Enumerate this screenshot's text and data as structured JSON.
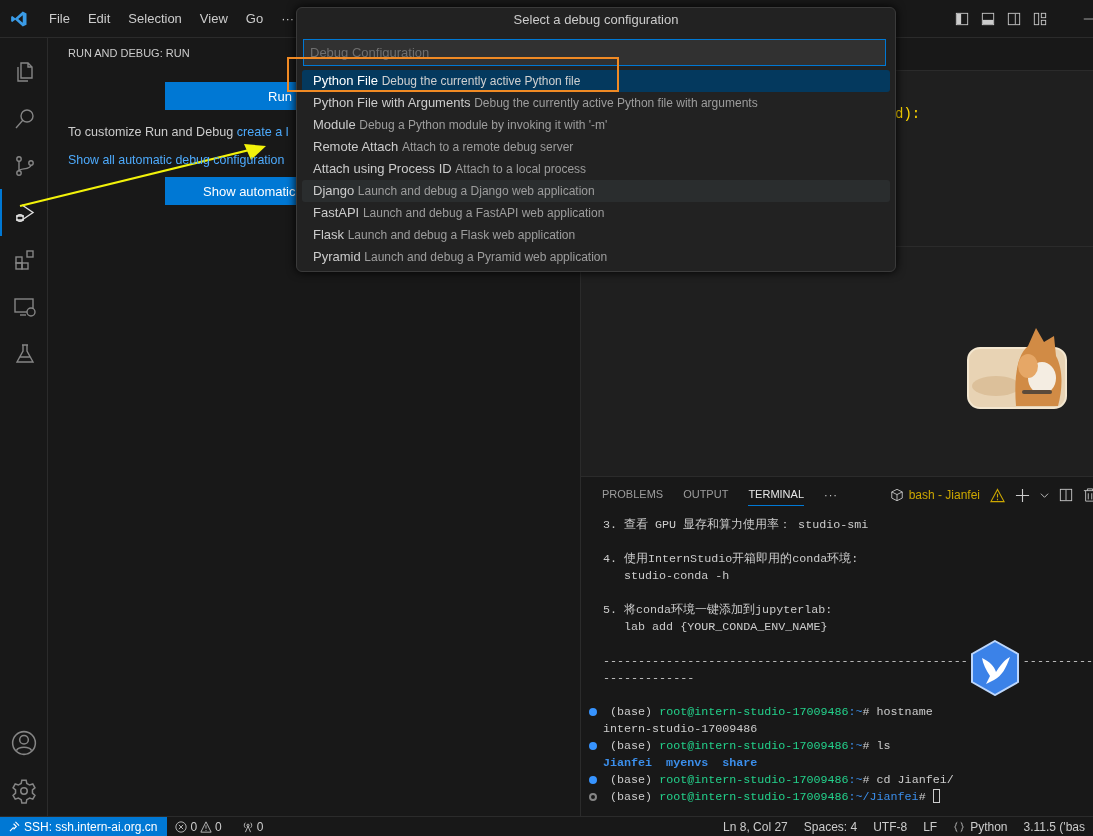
{
  "title_bar": {
    "menu": [
      "File",
      "Edit",
      "Selection",
      "View",
      "Go",
      "···"
    ],
    "layout_buttons": [
      {
        "kind": "sidebar-left"
      },
      {
        "kind": "panel"
      },
      {
        "kind": "sidebar-right"
      },
      {
        "kind": "customize"
      },
      {
        "kind": "minimize"
      }
    ]
  },
  "activity_bar": {
    "items": [
      {
        "kind": "explorer",
        "selected": false
      },
      {
        "kind": "search",
        "selected": false
      },
      {
        "kind": "source-control",
        "selected": false
      },
      {
        "kind": "run-debug",
        "selected": true
      },
      {
        "kind": "extensions",
        "selected": false
      },
      {
        "kind": "remote",
        "selected": false
      },
      {
        "kind": "testing",
        "selected": false
      }
    ],
    "bottom": [
      {
        "kind": "account"
      },
      {
        "kind": "settings"
      }
    ]
  },
  "sidebar": {
    "title": "RUN AND DEBUG: RUN",
    "run_button": "Run",
    "customize_text": "To customize Run and Debug",
    "create_link": "create a l",
    "show_all_link": "Show all automatic debug configuration",
    "show_button": "Show automatic"
  },
  "editor": {
    "code_fragment": "d):"
  },
  "palette": {
    "title": "Select a debug configuration",
    "placeholder": "Debug Configuration",
    "items": [
      {
        "label": "Python File",
        "description": "Debug the currently active Python file",
        "selected": true,
        "hovered": false
      },
      {
        "label": "Python File with Arguments",
        "description": "Debug the currently active Python file with arguments",
        "selected": false,
        "hovered": false
      },
      {
        "label": "Module",
        "description": "Debug a Python module by invoking it with '-m'",
        "selected": false,
        "hovered": false
      },
      {
        "label": "Remote Attach",
        "description": "Attach to a remote debug server",
        "selected": false,
        "hovered": false
      },
      {
        "label": "Attach using Process ID",
        "description": "Attach to a local process",
        "selected": false,
        "hovered": false
      },
      {
        "label": "Django",
        "description": "Launch and debug a Django web application",
        "selected": false,
        "hovered": true
      },
      {
        "label": "FastAPI",
        "description": "Launch and debug a FastAPI web application",
        "selected": false,
        "hovered": false
      },
      {
        "label": "Flask",
        "description": "Launch and debug a Flask web application",
        "selected": false,
        "hovered": false
      },
      {
        "label": "Pyramid",
        "description": "Launch and debug a Pyramid web application",
        "selected": false,
        "hovered": false
      }
    ]
  },
  "panel": {
    "tabs": [
      {
        "label": "PROBLEMS",
        "selected": false
      },
      {
        "label": "OUTPUT",
        "selected": false
      },
      {
        "label": "TERMINAL",
        "selected": true
      }
    ],
    "more": "···",
    "terminal_name": "bash - Jianfei",
    "lines": [
      {
        "kind": "text",
        "text": "3. 查看 GPU 显存和算力使用率： studio-smi"
      },
      {
        "kind": "blank"
      },
      {
        "kind": "text",
        "text": "4. 使用InternStudio开箱即用的conda环境:"
      },
      {
        "kind": "text",
        "text": "   studio-conda -h"
      },
      {
        "kind": "blank"
      },
      {
        "kind": "text",
        "text": "5. 将conda环境一键添加到jupyterlab:"
      },
      {
        "kind": "text",
        "text": "   lab add {YOUR_CONDA_ENV_NAME}"
      },
      {
        "kind": "blank"
      },
      {
        "kind": "split",
        "left": "----------------------------------------------------",
        "right": "----------"
      },
      {
        "kind": "text",
        "text": "-------------"
      },
      {
        "kind": "blank"
      },
      {
        "kind": "prompt",
        "done": true,
        "env": "(base)",
        "host": "root@intern-studio-17009486",
        "path": ":~",
        "command": "# hostname"
      },
      {
        "kind": "text",
        "text": "intern-studio-17009486"
      },
      {
        "kind": "prompt",
        "done": true,
        "env": "(base)",
        "host": "root@intern-studio-17009486",
        "path": ":~",
        "command": "# ls"
      },
      {
        "kind": "dirs",
        "text": "Jianfei  myenvs  share"
      },
      {
        "kind": "prompt",
        "done": true,
        "env": "(base)",
        "host": "root@intern-studio-17009486",
        "path": ":~",
        "command": "# cd Jianfei/"
      },
      {
        "kind": "prompt",
        "done": false,
        "env": "(base)",
        "host": "root@intern-studio-17009486",
        "path": ":~/Jianfei",
        "command": "# "
      }
    ]
  },
  "status_bar": {
    "left": [
      {
        "kind": "remote",
        "label": "SSH: ssh.intern-ai.org.cn"
      },
      {
        "kind": "problems",
        "errors": "0",
        "warnings": "0"
      },
      {
        "kind": "ports",
        "label": "0"
      }
    ],
    "right": [
      {
        "kind": "text",
        "label": "Ln 8, Col 27"
      },
      {
        "kind": "text",
        "label": "Spaces: 4"
      },
      {
        "kind": "text",
        "label": "UTF-8"
      },
      {
        "kind": "text",
        "label": "LF"
      },
      {
        "kind": "language",
        "label": "Python"
      },
      {
        "kind": "text",
        "label": "3.11.5 ('bas"
      }
    ]
  }
}
